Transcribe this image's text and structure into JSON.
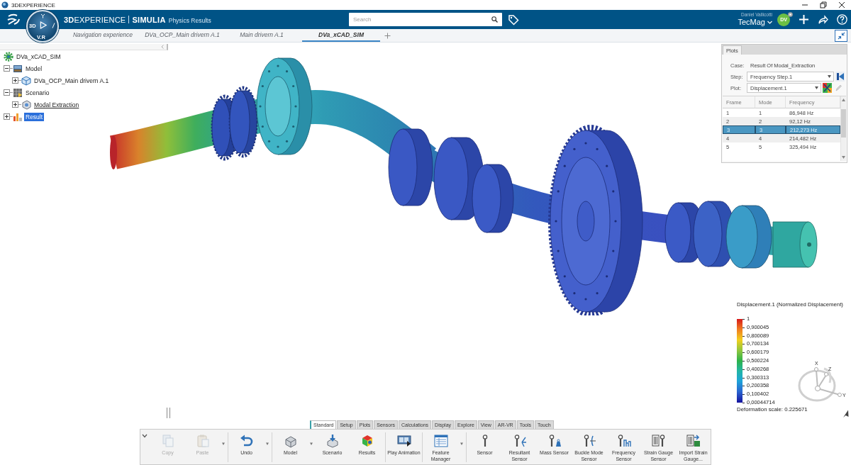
{
  "window": {
    "title": "3DEXPERIENCE"
  },
  "header": {
    "compass": {
      "left": "3D",
      "bottom": "V.R"
    },
    "platform": "**3D**EXPERIENCE",
    "brand": "SIMULIA",
    "app": "Physics Results",
    "search": {
      "placeholder": "Search"
    },
    "user": "Daniel Vallicotti",
    "tenant": "TecMag",
    "avatar": "DV"
  },
  "tabs": [
    {
      "label": "Navigation experience",
      "selected": false
    },
    {
      "label": "DVa_OCP_Main drivern A.1",
      "selected": false
    },
    {
      "label": "Main drivern A.1",
      "selected": false
    },
    {
      "label": "DVa_xCAD_SIM",
      "selected": true
    }
  ],
  "tree": [
    {
      "label": "DVa_xCAD_SIM",
      "kind": "simulation",
      "selected": false,
      "current": false,
      "children": [
        {
          "label": "Model",
          "kind": "model",
          "expanded": true,
          "selected": false,
          "current": false,
          "children": [
            {
              "label": "DVa_OCP_Main drivern A.1",
              "kind": "part",
              "expanded": false,
              "selected": false,
              "current": false
            }
          ]
        },
        {
          "label": "Scenario",
          "kind": "scenario",
          "expanded": true,
          "selected": false,
          "current": false,
          "children": [
            {
              "label": "Modal Extraction",
              "kind": "analysis",
              "expanded": false,
              "selected": false,
              "current": true
            }
          ]
        },
        {
          "label": "Result",
          "kind": "result",
          "expanded": false,
          "selected": true,
          "current": false
        }
      ]
    }
  ],
  "plots_panel": {
    "tab": "Plots",
    "fields": [
      {
        "kind": "text",
        "label": "Case:",
        "value": "Result Of Modal_Extraction"
      },
      {
        "kind": "step",
        "label": "Step:",
        "value": "Frequency Step.1"
      },
      {
        "kind": "plot",
        "label": "Plot:",
        "value": "Displacement.1"
      }
    ],
    "table": {
      "columns": [
        "Frame",
        "Mode",
        "Frequency"
      ],
      "rows": [
        {
          "cells": [
            "1",
            "1",
            "86,948 Hz"
          ],
          "selected": false
        },
        {
          "cells": [
            "2",
            "2",
            "92,12 Hz"
          ],
          "selected": false
        },
        {
          "cells": [
            "3",
            "3",
            "212,273 Hz"
          ],
          "selected": true
        },
        {
          "cells": [
            "4",
            "4",
            "214,482 Hz"
          ],
          "selected": false
        },
        {
          "cells": [
            "5",
            "5",
            "325,494 Hz"
          ],
          "selected": false
        }
      ]
    }
  },
  "legend": {
    "title": "Displacement.1 (Normalized Displacement)",
    "ticks": [
      "1",
      "0,900045",
      "0,800089",
      "0,700134",
      "0,600179",
      "0,500224",
      "0,400268",
      "0,300313",
      "0,200358",
      "0,100402",
      "0,00044714"
    ],
    "deformation_scale": "Deformation scale: 0.225671"
  },
  "triad": {
    "axes": [
      "X",
      "Z",
      "Y"
    ]
  },
  "action_bar": {
    "tabs": [
      {
        "label": "Standard",
        "selected": true
      },
      {
        "label": "Setup",
        "selected": false
      },
      {
        "label": "Plots",
        "selected": false
      },
      {
        "label": "Sensors",
        "selected": false
      },
      {
        "label": "Calculations",
        "selected": false
      },
      {
        "label": "Display",
        "selected": false
      },
      {
        "label": "Explore",
        "selected": false
      },
      {
        "label": "View",
        "selected": false
      },
      {
        "label": "AR-VR",
        "selected": false
      },
      {
        "label": "Tools",
        "selected": false
      },
      {
        "label": "Touch",
        "selected": false
      }
    ],
    "groups": [
      {
        "buttons": [
          {
            "kind": "copy",
            "label": "Copy",
            "disabled": true,
            "menu": false
          },
          {
            "kind": "paste",
            "label": "Paste",
            "disabled": true,
            "menu": true
          }
        ]
      },
      {
        "buttons": [
          {
            "kind": "undo",
            "label": "Undo",
            "disabled": false,
            "menu": true
          }
        ]
      },
      {
        "buttons": [
          {
            "kind": "model",
            "label": "Model",
            "disabled": false,
            "menu": true
          },
          {
            "kind": "scenario",
            "label": "Scenario",
            "disabled": false,
            "menu": false
          },
          {
            "kind": "results",
            "label": "Results",
            "disabled": false,
            "menu": false
          }
        ]
      },
      {
        "buttons": [
          {
            "kind": "play_animation",
            "label": "Play Animation",
            "disabled": false,
            "menu": false
          }
        ]
      },
      {
        "buttons": [
          {
            "kind": "feature_manager",
            "label": "Feature Manager",
            "disabled": false,
            "menu": true
          }
        ]
      },
      {
        "buttons": [
          {
            "kind": "sensor",
            "label": "Sensor",
            "disabled": false,
            "menu": false
          },
          {
            "kind": "resultant_sensor",
            "label": "Resultant Sensor",
            "disabled": false,
            "menu": false
          },
          {
            "kind": "mass_sensor",
            "label": "Mass Sensor",
            "disabled": false,
            "menu": false
          },
          {
            "kind": "buckle_sensor",
            "label": "Buckle Mode Sensor",
            "disabled": false,
            "menu": false
          },
          {
            "kind": "frequency_sensor",
            "label": "Frequency Sensor",
            "disabled": false,
            "menu": false
          },
          {
            "kind": "strain_gauge",
            "label": "Strain Gauge Sensor",
            "disabled": false,
            "menu": false
          },
          {
            "kind": "import_strain",
            "label": "Import Strain Gauge...",
            "disabled": false,
            "menu": false
          }
        ]
      }
    ]
  }
}
